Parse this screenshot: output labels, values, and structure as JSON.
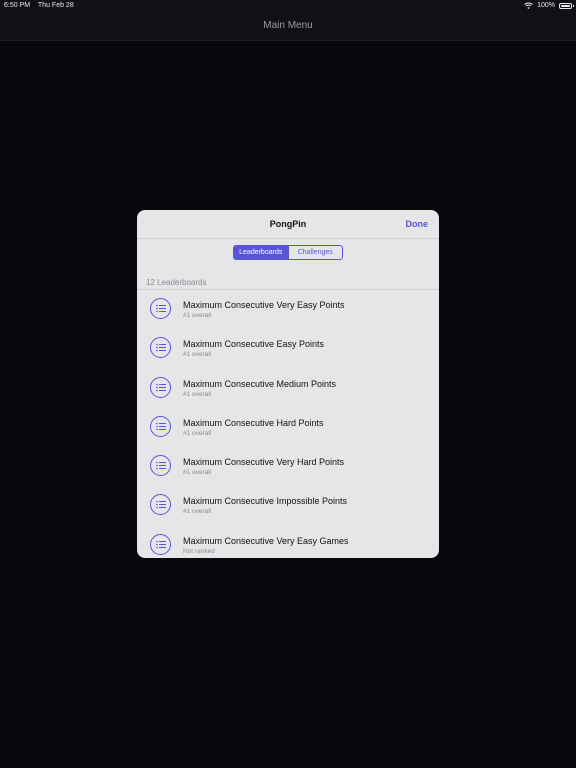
{
  "status": {
    "time": "6:50 PM",
    "date": "Thu Feb 28",
    "battery": "100%",
    "battery_level": 1.0,
    "wifi_icon": "wifi-icon"
  },
  "nav": {
    "title": "Main Menu"
  },
  "sheet": {
    "title": "PongPin",
    "done_label": "Done",
    "segments": [
      "Leaderboards",
      "Challenges"
    ],
    "active_segment": "Leaderboards",
    "count_label": "12 Leaderboards",
    "accent_color": "#5856d6",
    "rows": [
      {
        "title": "Maximum Consecutive Very Easy Points",
        "subtitle": "#1 overall",
        "icon": "list-icon"
      },
      {
        "title": "Maximum Consecutive Easy Points",
        "subtitle": "#1 overall",
        "icon": "list-icon"
      },
      {
        "title": "Maximum Consecutive Medium Points",
        "subtitle": "#1 overall",
        "icon": "list-icon"
      },
      {
        "title": "Maximum Consecutive Hard Points",
        "subtitle": "#1 overall",
        "icon": "list-icon"
      },
      {
        "title": "Maximum Consecutive Very Hard Points",
        "subtitle": "#1 overall",
        "icon": "list-icon"
      },
      {
        "title": "Maximum Consecutive Impossible Points",
        "subtitle": "#1 overall",
        "icon": "list-icon"
      },
      {
        "title": "Maximum Consecutive Very Easy Games",
        "subtitle": "Not ranked",
        "icon": "list-icon"
      }
    ]
  }
}
